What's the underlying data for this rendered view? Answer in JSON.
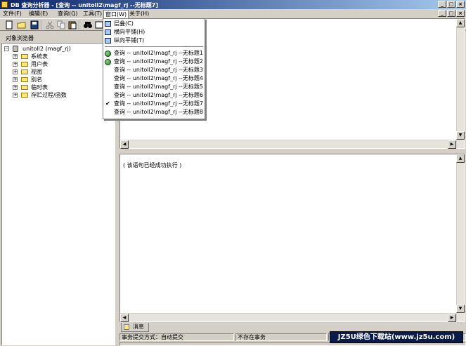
{
  "window": {
    "title": "DB 查询分析器 - [查询 -- unitoll2\\magf_rj --无标题7]",
    "icon": "app-icon"
  },
  "menubar": {
    "items": [
      "文件(F)",
      "编辑(E)",
      "查询(Q)",
      "工具(T)",
      "窗口(W)",
      "关于(H)"
    ]
  },
  "window_menu": {
    "arrange": [
      {
        "label": "层叠(C)",
        "icon": "cascade-icon"
      },
      {
        "label": "横向平铺(H)",
        "icon": "tile-horizontal-icon"
      },
      {
        "label": "纵向平铺(T)",
        "icon": "tile-vertical-icon"
      }
    ],
    "windows": [
      {
        "label": "查询 -- unitoll2\\magf_rj --无标题1",
        "icon": "globe-icon",
        "checked": false
      },
      {
        "label": "查询 -- unitoll2\\magf_rj --无标题2",
        "icon": "globe-icon",
        "checked": false
      },
      {
        "label": "查询 -- unitoll2\\magf_rj --无标题3",
        "icon": "",
        "checked": false
      },
      {
        "label": "查询 -- unitoll2\\magf_rj --无标题4",
        "icon": "",
        "checked": false
      },
      {
        "label": "查询 -- unitoll2\\magf_rj --无标题5",
        "icon": "",
        "checked": false
      },
      {
        "label": "查询 -- unitoll2\\magf_rj --无标题6",
        "icon": "",
        "checked": false
      },
      {
        "label": "查询 -- unitoll2\\magf_rj --无标题7",
        "icon": "",
        "checked": true
      },
      {
        "label": "查询 -- unitoll2\\magf_rj --无标题8",
        "icon": "",
        "checked": false
      }
    ]
  },
  "object_browser": {
    "header": "对象浏览器",
    "root": "unitoll2 (magf_rj)",
    "nodes": [
      "系统表",
      "用户表",
      "视图",
      "别名",
      "临时表",
      "存贮过程/函数"
    ]
  },
  "results": {
    "message": "( 该语句已经成功执行 )",
    "tab_label": "消息"
  },
  "statusbar": {
    "commit_mode": "事务提交方式：自动提交",
    "transaction": "不存在事务"
  },
  "watermark": "JZ5U绿色下载站(www.jz5u.com)",
  "colors": {
    "titlebar_start": "#0a246a",
    "titlebar_end": "#a6caf0",
    "face": "#d4d0c8"
  }
}
